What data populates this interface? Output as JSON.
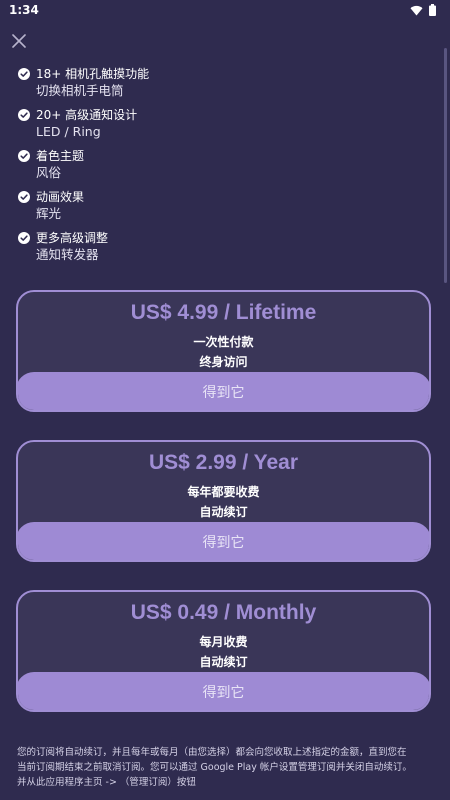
{
  "status": {
    "time": "1:34"
  },
  "icons": {
    "close": "close-icon",
    "check": "check-circle-icon",
    "wifi": "wifi-icon",
    "battery": "battery-icon"
  },
  "colors": {
    "background": "#2f2b4f",
    "card": "#3a3658",
    "accent": "#a08ed4",
    "button": "#9e8ad4"
  },
  "features": [
    {
      "title": "18+ 相机孔触摸功能",
      "subtitle": "切换相机手电筒"
    },
    {
      "title": "20+ 高级通知设计",
      "subtitle": "LED / Ring"
    },
    {
      "title": "着色主题",
      "subtitle": "风俗"
    },
    {
      "title": "动画效果",
      "subtitle": "辉光"
    },
    {
      "title": "更多高级调整",
      "subtitle": "通知转发器"
    }
  ],
  "plans": [
    {
      "price": "US$ 4.99 / Lifetime",
      "line1": "一次性付款",
      "line2": "终身访问",
      "button": "得到它"
    },
    {
      "price": "US$ 2.99 / Year",
      "line1": "每年都要收费",
      "line2": "自动续订",
      "button": "得到它"
    },
    {
      "price": "US$ 0.49 / Monthly",
      "line1": "每月收费",
      "line2": "自动续订",
      "button": "得到它"
    }
  ],
  "footer": {
    "line1": "您的订阅将自动续订，并且每年或每月（由您选择）都会向您收取上述指定的金额，直到您在",
    "line2": "当前订阅期结束之前取消订阅。您可以通过 Google Play 帐户设置管理订阅并关闭自动续订。",
    "line3": "并从此应用程序主页 -> （管理订阅）按钮"
  }
}
